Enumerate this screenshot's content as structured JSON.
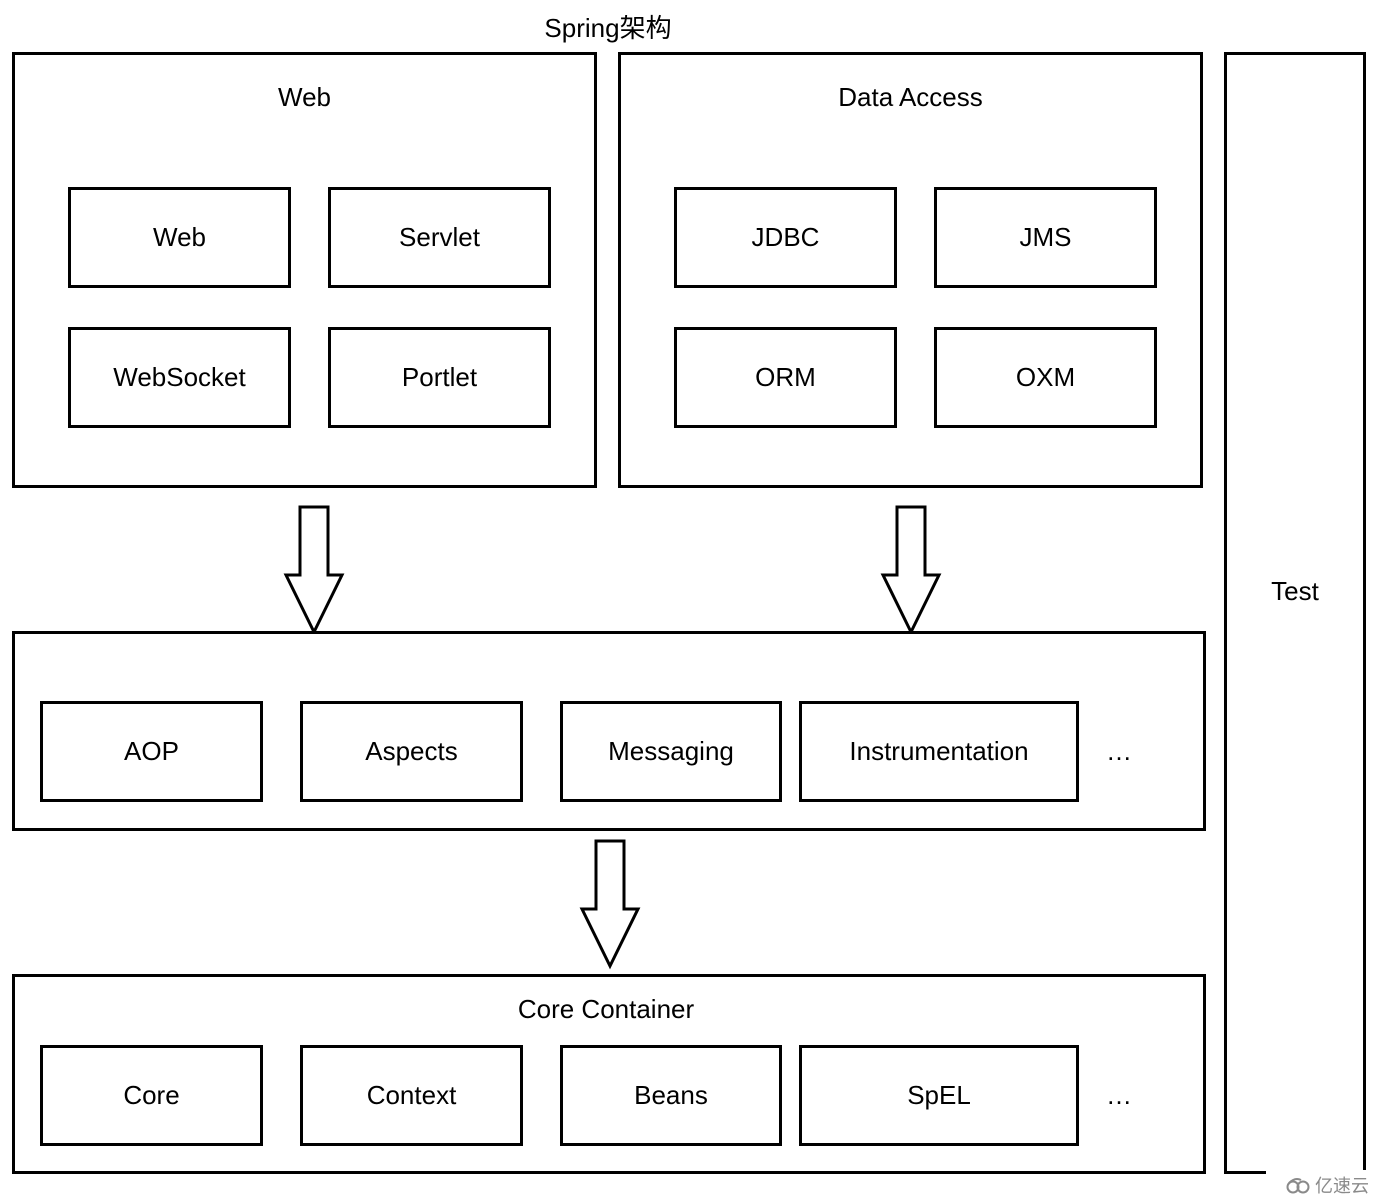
{
  "title": "Spring架构",
  "web_group": {
    "title": "Web",
    "modules": [
      "Web",
      "Servlet",
      "WebSocket",
      "Portlet"
    ]
  },
  "data_access_group": {
    "title": "Data Access",
    "modules": [
      "JDBC",
      "JMS",
      "ORM",
      "OXM"
    ]
  },
  "middle_group": {
    "modules": [
      "AOP",
      "Aspects",
      "Messaging",
      "Instrumentation"
    ],
    "more": "…"
  },
  "core_group": {
    "title": "Core Container",
    "modules": [
      "Core",
      "Context",
      "Beans",
      "SpEL"
    ],
    "more": "…"
  },
  "test_group": {
    "title": "Test"
  },
  "watermark": {
    "icon": "cloud-logo-icon",
    "text": "亿速云"
  }
}
